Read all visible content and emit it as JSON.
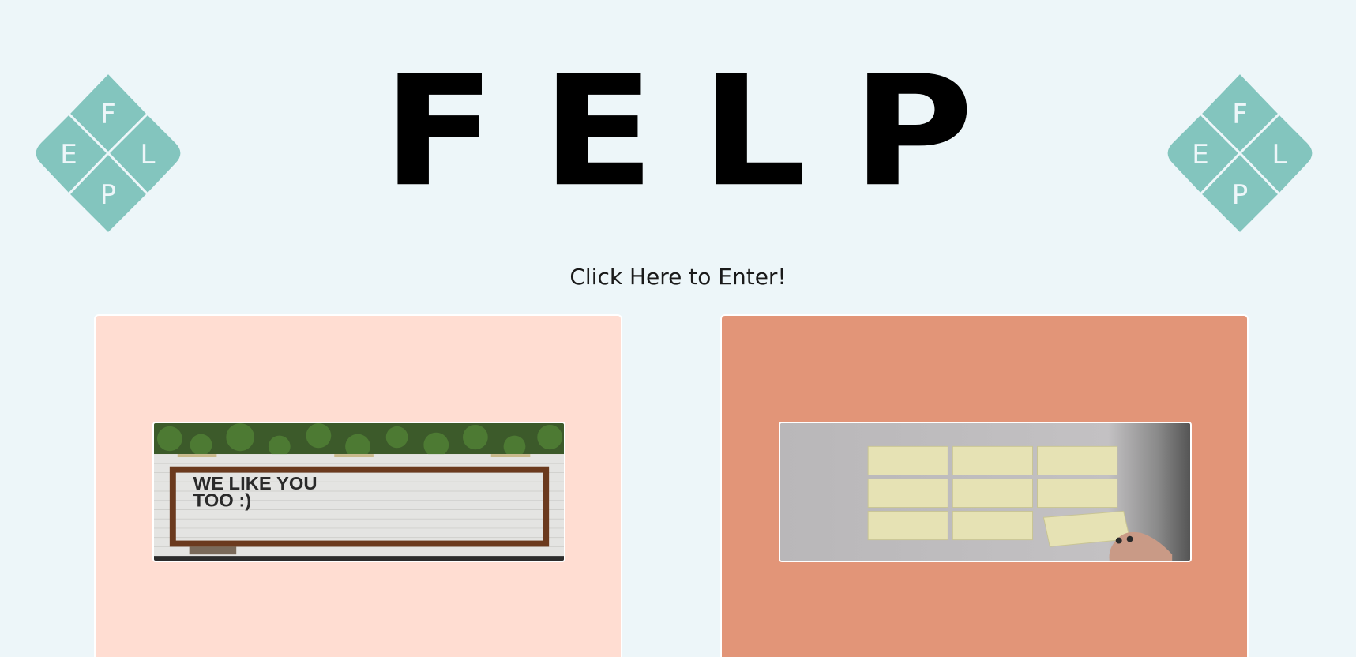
{
  "header": {
    "title": "FELP",
    "logo_letters": {
      "top": "F",
      "left": "E",
      "right": "L",
      "bottom": "P"
    }
  },
  "enter_link": "Click Here to Enter!",
  "cards": [
    {
      "image_sign_text_line1": "WE LIKE YOU",
      "image_sign_text_line2": "TOO :)"
    },
    {
      "image_description_icon": "sticky-notes-photo"
    }
  ],
  "colors": {
    "background": "#edf6f9",
    "logo_teal": "#83c5be",
    "card_light": "#ffddd2",
    "card_dark": "#e29578"
  }
}
